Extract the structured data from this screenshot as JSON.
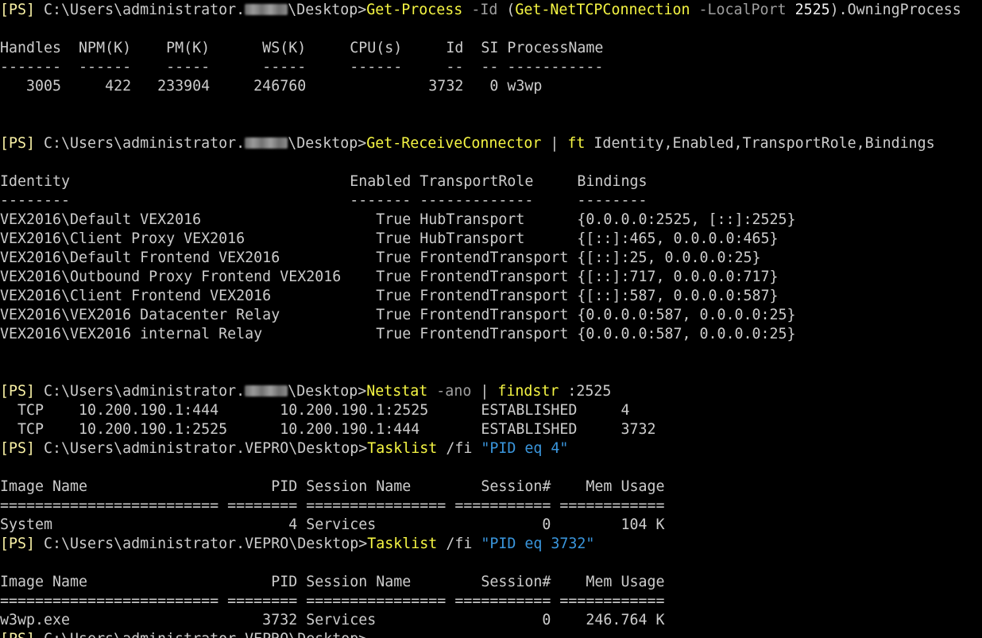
{
  "window": {
    "type": "powershell-console"
  },
  "colors": {
    "background": "#000000",
    "default": "#cccccc",
    "prompt_bracket": "#f9f1a5",
    "command": "#f5f543",
    "parameter": "#9e9e9e",
    "string": "#3a96dd",
    "output": "#f2f2f2"
  },
  "lines": [
    [
      {
        "text": "[PS] ",
        "style": "yellow"
      },
      {
        "text": "C:\\Users\\administrator.",
        "style": "default"
      },
      {
        "redact": true,
        "width": 54
      },
      {
        "text": "\\Desktop>",
        "style": "default"
      },
      {
        "text": "Get-Process",
        "style": "cmd"
      },
      {
        "text": " -Id ",
        "style": "gray"
      },
      {
        "text": "(",
        "style": "default"
      },
      {
        "text": "Get-NetTCPConnection",
        "style": "cmd"
      },
      {
        "text": " -LocalPort ",
        "style": "gray"
      },
      {
        "text": "2525",
        "style": "white"
      },
      {
        "text": ").OwningProcess",
        "style": "default"
      }
    ],
    [],
    [
      {
        "text": "Handles  NPM(K)    PM(K)      WS(K)     CPU(s)     Id  SI ProcessName",
        "style": "default"
      }
    ],
    [
      {
        "text": "-------  ------    -----      -----     ------     --  -- -----------",
        "style": "default"
      }
    ],
    [
      {
        "text": "   3005     422   233904     246760              3732   0 w3wp",
        "style": "default"
      }
    ],
    [],
    [],
    [
      {
        "text": "[PS] ",
        "style": "yellow"
      },
      {
        "text": "C:\\Users\\administrator.",
        "style": "default"
      },
      {
        "redact": true,
        "width": 54
      },
      {
        "text": "\\Desktop>",
        "style": "default"
      },
      {
        "text": "Get-ReceiveConnector",
        "style": "cmd"
      },
      {
        "text": " | ",
        "style": "default"
      },
      {
        "text": "ft",
        "style": "cmd"
      },
      {
        "text": " Identity,Enabled,TransportRole,Bindings",
        "style": "default"
      }
    ],
    [],
    [
      {
        "text": "Identity                                Enabled TransportRole     Bindings",
        "style": "default"
      }
    ],
    [
      {
        "text": "--------                                ------- -------------     --------",
        "style": "default"
      }
    ],
    [
      {
        "text": "VEX2016\\Default VEX2016                    True HubTransport      {0.0.0.0:2525, [::]:2525}",
        "style": "default"
      }
    ],
    [
      {
        "text": "VEX2016\\Client Proxy VEX2016               True HubTransport      {[::]:465, 0.0.0.0:465}",
        "style": "default"
      }
    ],
    [
      {
        "text": "VEX2016\\Default Frontend VEX2016           True FrontendTransport {[::]:25, 0.0.0.0:25}",
        "style": "default"
      }
    ],
    [
      {
        "text": "VEX2016\\Outbound Proxy Frontend VEX2016    True FrontendTransport {[::]:717, 0.0.0.0:717}",
        "style": "default"
      }
    ],
    [
      {
        "text": "VEX2016\\Client Frontend VEX2016            True FrontendTransport {[::]:587, 0.0.0.0:587}",
        "style": "default"
      }
    ],
    [
      {
        "text": "VEX2016\\VEX2016 Datacenter Relay           True FrontendTransport {0.0.0.0:587, 0.0.0.0:25}",
        "style": "default"
      }
    ],
    [
      {
        "text": "VEX2016\\VEX2016 internal Relay             True FrontendTransport {0.0.0.0:587, 0.0.0.0:25}",
        "style": "default"
      }
    ],
    [],
    [],
    [
      {
        "text": "[PS] ",
        "style": "yellow"
      },
      {
        "text": "C:\\Users\\administrator.",
        "style": "default"
      },
      {
        "redact": true,
        "width": 54
      },
      {
        "text": "\\Desktop>",
        "style": "default"
      },
      {
        "text": "Netstat",
        "style": "cmd"
      },
      {
        "text": " -ano",
        "style": "gray"
      },
      {
        "text": " | ",
        "style": "default"
      },
      {
        "text": "findstr",
        "style": "cmd"
      },
      {
        "text": " :2525",
        "style": "default"
      }
    ],
    [
      {
        "text": "  TCP    10.200.190.1:444       10.200.190.1:2525      ESTABLISHED     4",
        "style": "default"
      }
    ],
    [
      {
        "text": "  TCP    10.200.190.1:2525      10.200.190.1:444       ESTABLISHED     3732",
        "style": "default"
      }
    ],
    [
      {
        "text": "[PS] ",
        "style": "yellow"
      },
      {
        "text": "C:\\Users\\administrator.VEPRO\\Desktop>",
        "style": "default"
      },
      {
        "text": "Tasklist",
        "style": "cmd"
      },
      {
        "text": " /fi ",
        "style": "default"
      },
      {
        "text": "\"PID eq 4\"",
        "style": "teal"
      }
    ],
    [],
    [
      {
        "text": "Image Name                     PID Session Name        Session#    Mem Usage",
        "style": "default"
      }
    ],
    [
      {
        "text": "========================= ======== ================ =========== ============",
        "style": "default"
      }
    ],
    [
      {
        "text": "System                           4 Services                   0        104 K",
        "style": "default"
      }
    ],
    [
      {
        "text": "[PS] ",
        "style": "yellow"
      },
      {
        "text": "C:\\Users\\administrator.VEPRO\\Desktop>",
        "style": "default"
      },
      {
        "text": "Tasklist",
        "style": "cmd"
      },
      {
        "text": " /fi ",
        "style": "default"
      },
      {
        "text": "\"PID eq 3732\"",
        "style": "teal"
      }
    ],
    [],
    [
      {
        "text": "Image Name                     PID Session Name        Session#    Mem Usage",
        "style": "default"
      }
    ],
    [
      {
        "text": "========================= ======== ================ =========== ============",
        "style": "default"
      }
    ],
    [
      {
        "text": "w3wp.exe                      3732 Services                   0    246.764 K",
        "style": "default"
      }
    ],
    [
      {
        "text": "[PS] ",
        "style": "yellow"
      },
      {
        "text": "C:\\Users\\administrator.VEPRO\\Desktop>",
        "style": "default"
      }
    ]
  ]
}
